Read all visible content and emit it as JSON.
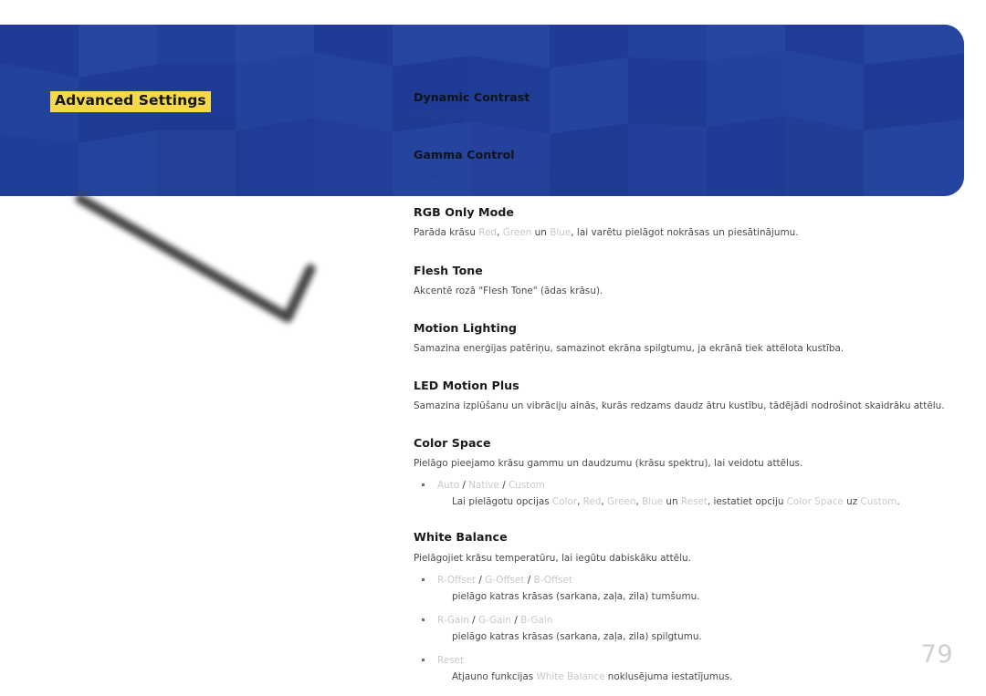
{
  "page": {
    "title": "Advanced Settings",
    "number": "79",
    "accent_blue": "#21409a",
    "highlight_yellow": "#f5d84b",
    "option_gray": "#c9c9c9"
  },
  "sections": [
    {
      "heading": "Dynamic Contrast",
      "description": "Pielāgojet ekrāna kontrastu."
    },
    {
      "heading": "Gamma Control",
      "description": "Pielāgojet pamatkrāsu intensitāti."
    },
    {
      "heading": "RGB Only Mode",
      "desc_parts": [
        {
          "text": "Parāda krāsu ",
          "style": "normal"
        },
        {
          "text": "Red",
          "style": "option"
        },
        {
          "text": ", ",
          "style": "normal"
        },
        {
          "text": "Green",
          "style": "option"
        },
        {
          "text": " un ",
          "style": "normal"
        },
        {
          "text": "Blue",
          "style": "option"
        },
        {
          "text": ", lai varētu pielāgot nokrāsas un piesātinājumu.",
          "style": "normal"
        }
      ]
    },
    {
      "heading": "Flesh Tone",
      "description": "Akcentē rozā \"Flesh Tone\" (ādas krāsu)."
    },
    {
      "heading": "Motion Lighting",
      "description": "Samazina enerģijas patēriņu, samazinot ekrāna spilgtumu, ja ekrānā tiek attēlota kustība."
    },
    {
      "heading": "LED Motion Plus",
      "description": "Samazina izplūšanu un vibrāciju ainās, kurās redzams daudz ātru kustību, tādējādi nodrošinot skaidrāku attēlu."
    },
    {
      "heading": "Color Space",
      "description": "Pielāgo pieejamo krāsu gammu un daudzumu (krāsu spektru), lai veidotu attēlus.",
      "bullets": [
        {
          "head_parts": [
            {
              "text": "Auto",
              "style": "option"
            },
            {
              "text": " / ",
              "style": "sep"
            },
            {
              "text": "Native",
              "style": "option"
            },
            {
              "text": " / ",
              "style": "sep"
            },
            {
              "text": "Custom",
              "style": "option"
            }
          ],
          "sub_parts": [
            {
              "text": "Lai pielāgotu opcijas ",
              "style": "normal"
            },
            {
              "text": "Color",
              "style": "option"
            },
            {
              "text": ", ",
              "style": "normal"
            },
            {
              "text": "Red",
              "style": "option"
            },
            {
              "text": ", ",
              "style": "normal"
            },
            {
              "text": "Green",
              "style": "option"
            },
            {
              "text": ", ",
              "style": "normal"
            },
            {
              "text": "Blue",
              "style": "option"
            },
            {
              "text": " un ",
              "style": "normal"
            },
            {
              "text": "Reset",
              "style": "option"
            },
            {
              "text": ", iestatiet opciju ",
              "style": "normal"
            },
            {
              "text": "Color Space",
              "style": "option"
            },
            {
              "text": " uz ",
              "style": "normal"
            },
            {
              "text": "Custom",
              "style": "option"
            },
            {
              "text": ".",
              "style": "normal"
            }
          ]
        }
      ]
    },
    {
      "heading": "White Balance",
      "description": "Pielāgojiet krāsu temperatūru, lai iegūtu dabiskāku attēlu.",
      "bullets": [
        {
          "head_parts": [
            {
              "text": "R-Offset",
              "style": "option"
            },
            {
              "text": " / ",
              "style": "sep"
            },
            {
              "text": "G-Offset",
              "style": "option"
            },
            {
              "text": " / ",
              "style": "sep"
            },
            {
              "text": "B-Offset",
              "style": "option"
            }
          ],
          "sub_parts": [
            {
              "text": "pielāgo katras krāsas (sarkana, zaļa, zila) tumšumu.",
              "style": "normal"
            }
          ]
        },
        {
          "head_parts": [
            {
              "text": "R-Gain",
              "style": "option"
            },
            {
              "text": " / ",
              "style": "sep"
            },
            {
              "text": "G-Gain",
              "style": "option"
            },
            {
              "text": " / ",
              "style": "sep"
            },
            {
              "text": "B-Gain",
              "style": "option"
            }
          ],
          "sub_parts": [
            {
              "text": "pielāgo katras krāsas (sarkana, zaļa, zila) spilgtumu.",
              "style": "normal"
            }
          ]
        },
        {
          "head_parts": [
            {
              "text": "Reset",
              "style": "option"
            }
          ],
          "sub_parts": [
            {
              "text": "Atjauno funkcijas ",
              "style": "normal"
            },
            {
              "text": "White Balance",
              "style": "option"
            },
            {
              "text": " noklusējuma iestatījumus.",
              "style": "normal"
            }
          ]
        }
      ]
    }
  ]
}
